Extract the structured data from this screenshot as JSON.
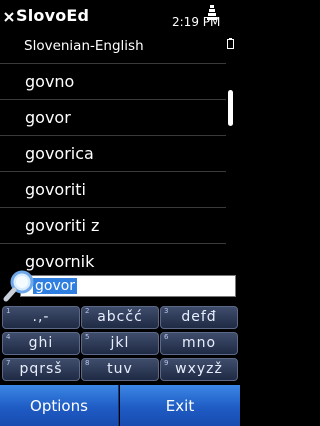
{
  "app": {
    "title": "SlovoEd",
    "clock": "2:19 PM",
    "dictionary": "Slovenian-English"
  },
  "list": {
    "items": [
      {
        "label": "govno"
      },
      {
        "label": "govor"
      },
      {
        "label": "govorica"
      },
      {
        "label": "govoriti"
      },
      {
        "label": "govoriti z"
      },
      {
        "label": "govornik"
      }
    ]
  },
  "search": {
    "value": "govor"
  },
  "keypad": {
    "keys": [
      {
        "num": "1",
        "chars": ".,-"
      },
      {
        "num": "2",
        "chars": "abcčć"
      },
      {
        "num": "3",
        "chars": "defđ"
      },
      {
        "num": "4",
        "chars": "ghi"
      },
      {
        "num": "5",
        "chars": "jkl"
      },
      {
        "num": "6",
        "chars": "mno"
      },
      {
        "num": "7",
        "chars": "pqrsš"
      },
      {
        "num": "8",
        "chars": "tuv"
      },
      {
        "num": "9",
        "chars": "wxyzž"
      }
    ]
  },
  "softkeys": {
    "left": "Options",
    "right": "Exit"
  },
  "colors": {
    "accent": "#1f5cc4",
    "selection": "#2f7fe0",
    "key": "#2c3854"
  },
  "icons": {
    "close": "close-icon",
    "signal": "signal-icon",
    "battery": "battery-icon",
    "search": "magnifier-icon"
  }
}
